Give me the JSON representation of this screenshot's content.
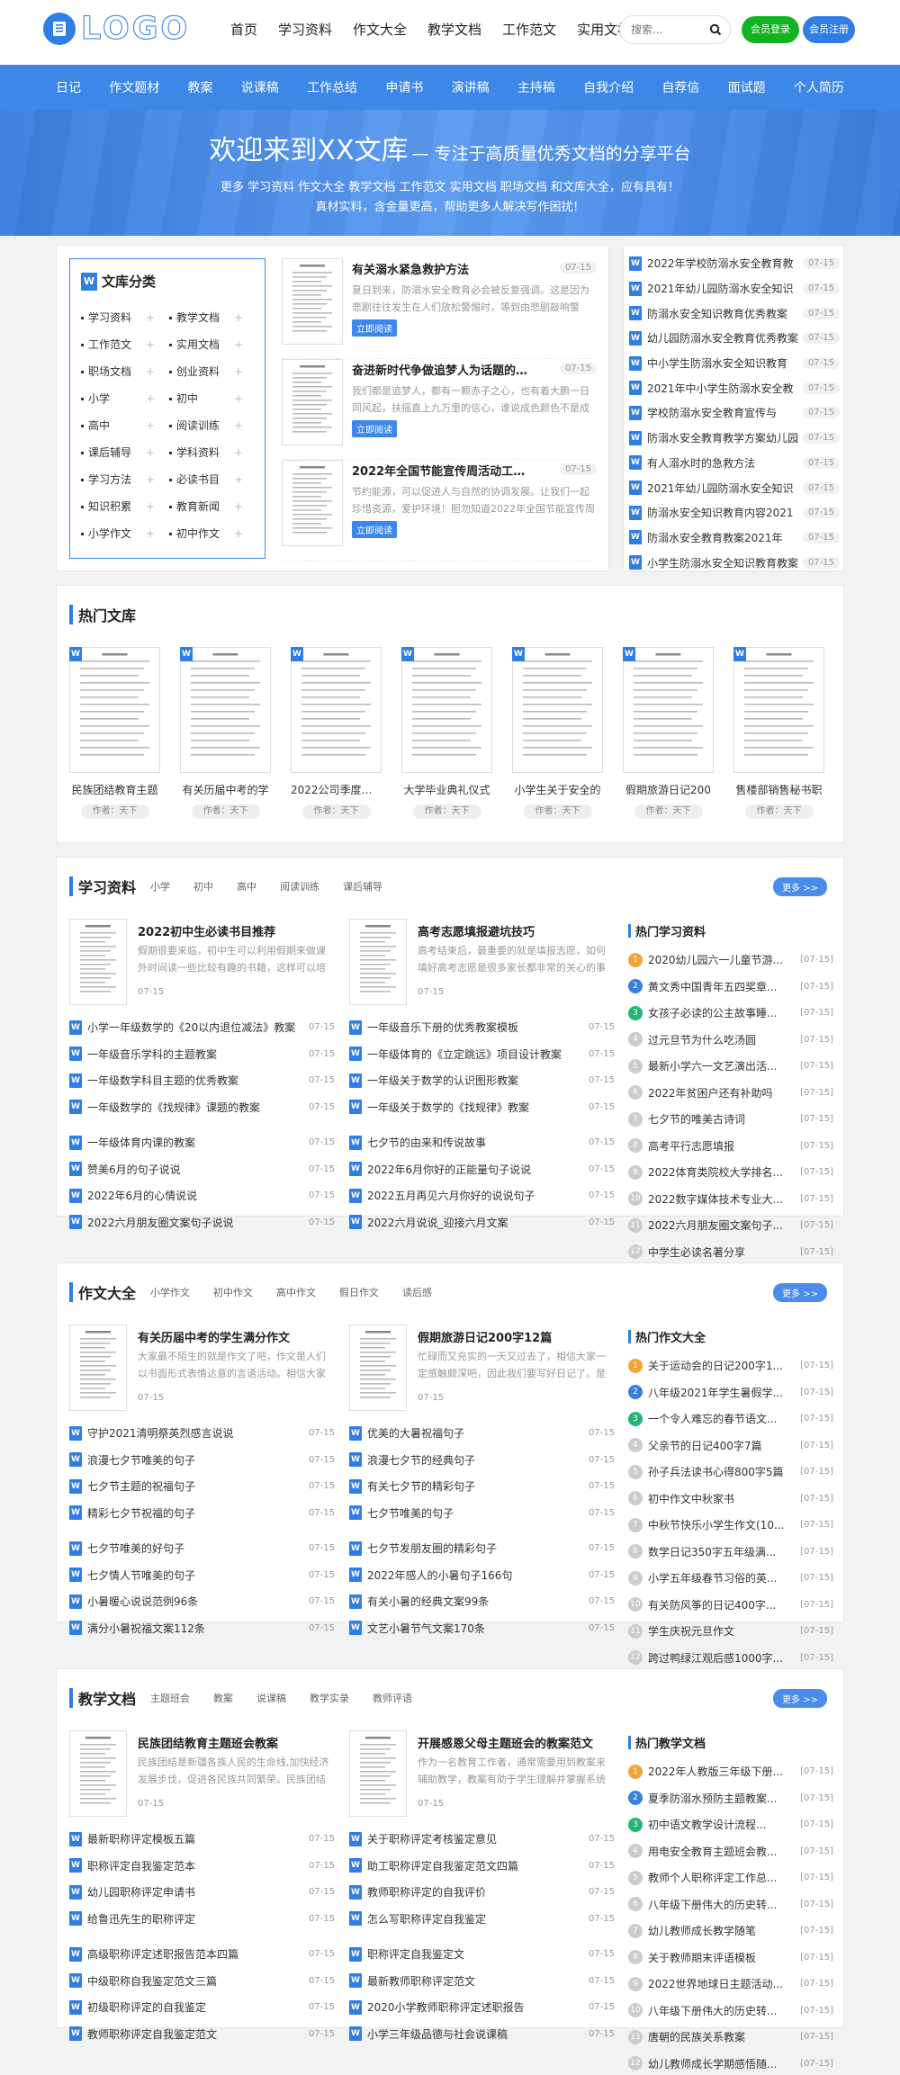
{
  "header": {
    "logo_text": "LOGO",
    "nav": [
      "首页",
      "学习资料",
      "作文大全",
      "教学文档",
      "工作范文",
      "实用文档"
    ],
    "search_placeholder": "搜索...",
    "login_label": "会员登录",
    "register_label": "会员注册"
  },
  "catnav": [
    "日记",
    "作文题材",
    "教案",
    "说课稿",
    "工作总结",
    "申请书",
    "演讲稿",
    "主持稿",
    "自我介绍",
    "自荐信",
    "面试题",
    "个人简历"
  ],
  "banner": {
    "title": "欢迎来到XX文库",
    "subtitle": "专注于高质量优秀文档的分享平台",
    "line1": "更多 学习资料 作文大全 教学文档 工作范文 实用文档 职场文档 和文库大全，应有具有！",
    "line2": "真材实料，含金量更高，帮助更多人解决写作困扰！"
  },
  "library": {
    "title": "文库分类",
    "items": [
      {
        "label": "学习资料",
        "plus": "+"
      },
      {
        "label": "教学文档",
        "plus": "+"
      },
      {
        "label": "工作范文",
        "plus": "+"
      },
      {
        "label": "实用文档",
        "plus": "+"
      },
      {
        "label": "职场文档",
        "plus": "+"
      },
      {
        "label": "创业资料",
        "plus": "+"
      },
      {
        "label": "小学",
        "plus": "+"
      },
      {
        "label": "初中",
        "plus": "+"
      },
      {
        "label": "高中",
        "plus": "+"
      },
      {
        "label": "阅读训练",
        "plus": "+"
      },
      {
        "label": "课后辅导",
        "plus": "+"
      },
      {
        "label": "学科资料",
        "plus": "+"
      },
      {
        "label": "学习方法",
        "plus": "+"
      },
      {
        "label": "必读书目",
        "plus": "+"
      },
      {
        "label": "知识积累",
        "plus": "+"
      },
      {
        "label": "教育新闻",
        "plus": "+"
      },
      {
        "label": "小学作文",
        "plus": "+"
      },
      {
        "label": "初中作文",
        "plus": "+"
      }
    ]
  },
  "featured": [
    {
      "title": "有关溺水紧急救护方法",
      "date": "07-15",
      "desc": "夏日到来，防溺水安全教育必会被反复强调。这是因为悲剧往往发生在人们放松警惕时，等到由悲剧敲响警钟，代价太大。",
      "btn": "立即阅读"
    },
    {
      "title": "奋进新时代争做追梦人为话题的高中作",
      "date": "07-15",
      "desc": "我们都是追梦人，都有一颗赤子之心，也有着大鹏一日同风起，扶摇直上九万里的信心，谁说成色颜色不是成色？",
      "btn": "立即阅读"
    },
    {
      "title": "2022年全国节能宣传周活动工作总结范",
      "date": "07-15",
      "desc": "节约能源，可以促进人与自然的协调发展。让我们一起珍惜资源，爱护环境！胆勿知道2022年全国节能宣传周活动",
      "btn": "立即阅读"
    }
  ],
  "right_list": [
    {
      "title": "2022年学校防溺水安全教育教",
      "date": "07-15"
    },
    {
      "title": "2021年幼儿园防溺水安全知识",
      "date": "07-15"
    },
    {
      "title": "防溺水安全知识教育优秀教案",
      "date": "07-15"
    },
    {
      "title": "幼儿园防溺水安全教育优秀教案",
      "date": "07-15"
    },
    {
      "title": "中小学生防溺水安全知识教育",
      "date": "07-15"
    },
    {
      "title": "2021年中小学生防溺水安全教",
      "date": "07-15"
    },
    {
      "title": "学校防溺水安全教育宣传与",
      "date": "07-15"
    },
    {
      "title": "防溺水安全教育教学方案幼儿园",
      "date": "07-15"
    },
    {
      "title": "有人溺水时的急救方法",
      "date": "07-15"
    },
    {
      "title": "2021年幼儿园防溺水安全知识",
      "date": "07-15"
    },
    {
      "title": "防溺水安全知识教育内容2021",
      "date": "07-15"
    },
    {
      "title": "防溺水安全教育教案2021年",
      "date": "07-15"
    },
    {
      "title": "小学生防溺水安全知识教育教案",
      "date": "07-15"
    }
  ],
  "hot": {
    "title": "热门文库",
    "items": [
      {
        "name": "民族团结教育主题",
        "author": "作者：天下"
      },
      {
        "name": "有关历届中考的学",
        "author": "作者：天下"
      },
      {
        "name": "2022公司季度工作",
        "author": "作者：天下"
      },
      {
        "name": "大学毕业典礼仪式",
        "author": "作者：天下"
      },
      {
        "name": "小学生关于安全的",
        "author": "作者：天下"
      },
      {
        "name": "假期旅游日记200",
        "author": "作者：天下"
      },
      {
        "name": "售楼部销售秘书职",
        "author": "作者：天下"
      }
    ]
  },
  "study": {
    "title": "学习资料",
    "tabs": [
      "小学",
      "初中",
      "高中",
      "阅读训练",
      "课后辅导"
    ],
    "more": "更多 >>",
    "col1": {
      "feature": {
        "title": "2022初中生必读书目推荐",
        "desc": "假期很要来临，初中生可以利用假期来做课外时间读一些比较有趣的书籍，这样可以培养自己的",
        "date": "07-15"
      },
      "list": [
        {
          "t": "小学一年级数学的《20以内退位减法》教案",
          "d": "07-15"
        },
        {
          "t": "一年级音乐学科的主题教案",
          "d": "07-15"
        },
        {
          "t": "一年级数学科目主题的优秀教案",
          "d": "07-15"
        },
        {
          "t": "一年级数学的《找规律》课题的教案",
          "d": "07-15"
        }
      ],
      "list2": [
        {
          "t": "一年级体育内课的教案",
          "d": "07-15"
        },
        {
          "t": "赞美6月的句子说说",
          "d": "07-15"
        },
        {
          "t": "2022年6月的心情说说",
          "d": "07-15"
        },
        {
          "t": "2022六月朋友圈文案句子说说",
          "d": "07-15"
        }
      ]
    },
    "col2": {
      "feature": {
        "title": "高考志愿填报避坑技巧",
        "desc": "高考结束后，最重要的就是填报志愿，如何填好高考志愿是很多家长都非常的关心的事情，",
        "date": "07-15"
      },
      "list": [
        {
          "t": "一年级音乐下册的优秀教案模板",
          "d": "07-15"
        },
        {
          "t": "一年级体育的《立定跳远》项目设计教案",
          "d": "07-15"
        },
        {
          "t": "一年级关于数学的认识图形教案",
          "d": "07-15"
        },
        {
          "t": "一年级关于数学的《找规律》教案",
          "d": "07-15"
        }
      ],
      "list2": [
        {
          "t": "七夕节的由来和传说故事",
          "d": "07-15"
        },
        {
          "t": "2022年6月你好的正能量句子说说",
          "d": "07-15"
        },
        {
          "t": "2022五月再见六月你好的说说句子",
          "d": "07-15"
        },
        {
          "t": "2022六月说说_迎接六月文案",
          "d": "07-15"
        }
      ]
    },
    "rank": {
      "title": "热门学习资料",
      "items": [
        {
          "n": "1",
          "t": "2020幼儿园六一儿童节游...",
          "d": "[07-15]"
        },
        {
          "n": "2",
          "t": "黄文秀中国青年五四奖章...",
          "d": "[07-15]"
        },
        {
          "n": "3",
          "t": "女孩子必读的公主故事睡...",
          "d": "[07-15]"
        },
        {
          "n": "4",
          "t": "过元旦节为什么吃汤圆",
          "d": "[07-15]"
        },
        {
          "n": "5",
          "t": "最新小学六一文艺演出活...",
          "d": "[07-15]"
        },
        {
          "n": "6",
          "t": "2022年贫困户还有补助吗",
          "d": "[07-15]"
        },
        {
          "n": "7",
          "t": "七夕节的唯美古诗词",
          "d": "[07-15]"
        },
        {
          "n": "8",
          "t": "高考平行志愿填报",
          "d": "[07-15]"
        },
        {
          "n": "9",
          "t": "2022体育类院校大学排名...",
          "d": "[07-15]"
        },
        {
          "n": "10",
          "t": "2022数字媒体技术专业大...",
          "d": "[07-15]"
        },
        {
          "n": "11",
          "t": "2022六月朋友圈文案句子...",
          "d": "[07-15]"
        },
        {
          "n": "12",
          "t": "中学生必读名著分享",
          "d": "[07-15]"
        }
      ]
    }
  },
  "composition": {
    "title": "作文大全",
    "tabs": [
      "小学作文",
      "初中作文",
      "高中作文",
      "假日作文",
      "读后感"
    ],
    "more": "更多 >>",
    "col1": {
      "feature": {
        "title": "有关历届中考的学生满分作文",
        "desc": "大家最不陌生的就是作文了吧，作文是人们以书面形式表情达意的言语活动。相信大家都对",
        "date": "07-15"
      },
      "list": [
        {
          "t": "守护2021清明祭英烈感言说说",
          "d": "07-15"
        },
        {
          "t": "浪漫七夕节唯美的句子",
          "d": "07-15"
        },
        {
          "t": "七夕节主题的祝福句子",
          "d": "07-15"
        },
        {
          "t": "精彩七夕节祝福的句子",
          "d": "07-15"
        }
      ],
      "list2": [
        {
          "t": "七夕节唯美的好句子",
          "d": "07-15"
        },
        {
          "t": "七夕情人节唯美的句子",
          "d": "07-15"
        },
        {
          "t": "小暑暖心说说范例96条",
          "d": "07-15"
        },
        {
          "t": "满分小暑祝福文案112条",
          "d": "07-15"
        }
      ]
    },
    "col2": {
      "feature": {
        "title": "假期旅游日记200字12篇",
        "desc": "忙碌而又充实的一天又过去了，相信大家一定感触颇深吧，因此我们要写好日记了。是不是",
        "date": "07-15"
      },
      "list": [
        {
          "t": "优美的大暑祝福句子",
          "d": "07-15"
        },
        {
          "t": "浪漫七夕节的经典句子",
          "d": "07-15"
        },
        {
          "t": "有关七夕节的精彩句子",
          "d": "07-15"
        },
        {
          "t": "七夕节唯美的句子",
          "d": "07-15"
        }
      ],
      "list2": [
        {
          "t": "七夕节发朋友圈的精彩句子",
          "d": "07-15"
        },
        {
          "t": "2022年感人的小暑句子166句",
          "d": "07-15"
        },
        {
          "t": "有关小暑的经典文案99条",
          "d": "07-15"
        },
        {
          "t": "文艺小暑节气文案170条",
          "d": "07-15"
        }
      ]
    },
    "rank": {
      "title": "热门作文大全",
      "items": [
        {
          "n": "1",
          "t": "关于运动会的日记200字1...",
          "d": "[07-15]"
        },
        {
          "n": "2",
          "t": "八年级2021年学生暑假学...",
          "d": "[07-15]"
        },
        {
          "n": "3",
          "t": "一个令人难忘的春节语文...",
          "d": "[07-15]"
        },
        {
          "n": "4",
          "t": "父亲节的日记400字7篇",
          "d": "[07-15]"
        },
        {
          "n": "5",
          "t": "孙子兵法读书心得800字5篇",
          "d": "[07-15]"
        },
        {
          "n": "6",
          "t": "初中作文中秋家书",
          "d": "[07-15]"
        },
        {
          "n": "7",
          "t": "中秋节快乐小学生作文(10...",
          "d": "[07-15]"
        },
        {
          "n": "8",
          "t": "数学日记350字五年级满...",
          "d": "[07-15]"
        },
        {
          "n": "9",
          "t": "小学五年级春节习俗的英...",
          "d": "[07-15]"
        },
        {
          "n": "10",
          "t": "有关防风筝的日记400字...",
          "d": "[07-15]"
        },
        {
          "n": "11",
          "t": "学生庆祝元旦作文",
          "d": "[07-15]"
        },
        {
          "n": "12",
          "t": "跨过鸭绿江观后感1000字...",
          "d": "[07-15]"
        }
      ]
    }
  },
  "teaching": {
    "title": "教学文档",
    "tabs": [
      "主题班会",
      "教案",
      "说课稿",
      "教学实录",
      "教师评语"
    ],
    "more": "更多 >>",
    "col1": {
      "feature": {
        "title": "民族团结教育主题班会教案",
        "desc": "民族团结是新疆各族人民的生命线,加快经济发展步伐，促进各民族共同繁荣。民族团结是",
        "date": "07-15"
      },
      "list": [
        {
          "t": "最新职称评定模板五篇",
          "d": "07-15"
        },
        {
          "t": "职称评定自我鉴定范本",
          "d": "07-15"
        },
        {
          "t": "幼儿园职称评定申请书",
          "d": "07-15"
        },
        {
          "t": "给鲁迅先生的职称评定",
          "d": "07-15"
        }
      ],
      "list2": [
        {
          "t": "高级职称评定述职报告范本四篇",
          "d": "07-15"
        },
        {
          "t": "中级职称自我鉴定范文三篇",
          "d": "07-15"
        },
        {
          "t": "初级职称评定的自我鉴定",
          "d": "07-15"
        },
        {
          "t": "教师职称评定自我鉴定范文",
          "d": "07-15"
        }
      ]
    },
    "col2": {
      "feature": {
        "title": "开展感恩父母主题班会的教案范文",
        "desc": "作为一名教育工作者，通常需要用到教案来辅助教学，教案有助于学生理解并掌握系统的知",
        "date": "07-15"
      },
      "list": [
        {
          "t": "关于职称评定考核鉴定意见",
          "d": "07-15"
        },
        {
          "t": "助工职称评定自我鉴定范文四篇",
          "d": "07-15"
        },
        {
          "t": "教师职称评定的自我评价",
          "d": "07-15"
        },
        {
          "t": "怎么写职称评定自我鉴定",
          "d": "07-15"
        }
      ],
      "list2": [
        {
          "t": "职称评定自我鉴定文",
          "d": "07-15"
        },
        {
          "t": "最新教师职称评定范文",
          "d": "07-15"
        },
        {
          "t": "2020小学教师职称评定述职报告",
          "d": "07-15"
        },
        {
          "t": "小学三年级品德与社会说课稿",
          "d": "07-15"
        }
      ]
    },
    "rank": {
      "title": "热门教学文档",
      "items": [
        {
          "n": "1",
          "t": "2022年人教版三年级下册...",
          "d": "[07-15]"
        },
        {
          "n": "2",
          "t": "夏季防溺水预防主题教案...",
          "d": "[07-15]"
        },
        {
          "n": "3",
          "t": "初中语文教学设计流程...",
          "d": "[07-15]"
        },
        {
          "n": "4",
          "t": "用电安全教育主题班会教...",
          "d": "[07-15]"
        },
        {
          "n": "5",
          "t": "教师个人职称评定工作总...",
          "d": "[07-15]"
        },
        {
          "n": "6",
          "t": "八年级下册伟大的历史转...",
          "d": "[07-15]"
        },
        {
          "n": "7",
          "t": "幼儿教师成长教学随笔",
          "d": "[07-15]"
        },
        {
          "n": "8",
          "t": "关于教师期末评语模板",
          "d": "[07-15]"
        },
        {
          "n": "9",
          "t": "2022世界地球日主题活动...",
          "d": "[07-15]"
        },
        {
          "n": "10",
          "t": "八年级下册伟大的历史转...",
          "d": "[07-15]"
        },
        {
          "n": "11",
          "t": "唐朝的民族关系教案",
          "d": "[07-15]"
        },
        {
          "n": "12",
          "t": "幼儿教师成长学期感悟随...",
          "d": "[07-15]"
        }
      ]
    }
  }
}
